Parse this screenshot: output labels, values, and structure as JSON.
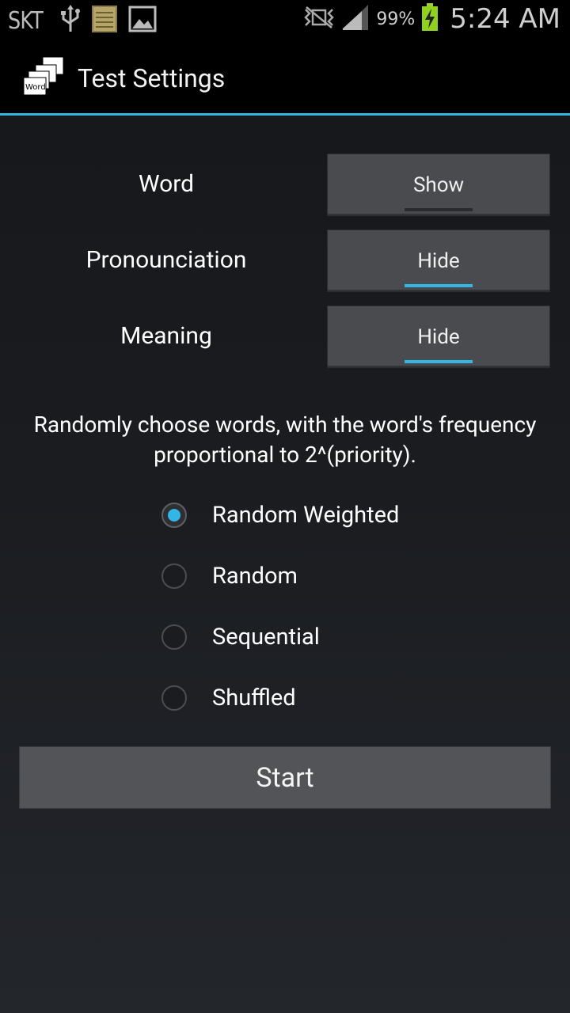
{
  "status_bar": {
    "carrier": "SKT",
    "battery_percent": "99%",
    "time": "5:24 AM",
    "icons": [
      "usb-icon",
      "notes-icon",
      "gallery-icon",
      "vibrate-icon",
      "signal-icon",
      "battery-charging-icon"
    ],
    "accent_color": "#33b5e5"
  },
  "action_bar": {
    "title": "Test Settings",
    "icon": "word-cards-app-icon"
  },
  "settings": {
    "word": {
      "label": "Word",
      "state": "Show"
    },
    "pronounciation": {
      "label": "Pronounciation",
      "state": "Hide"
    },
    "meaning": {
      "label": "Meaning",
      "state": "Hide"
    }
  },
  "mode": {
    "description": "Randomly choose words, with the word's frequency proportional to 2^(priority).",
    "options": [
      {
        "label": "Random Weighted",
        "selected": true
      },
      {
        "label": "Random",
        "selected": false
      },
      {
        "label": "Sequential",
        "selected": false
      },
      {
        "label": "Shuffled",
        "selected": false
      }
    ]
  },
  "start_button": {
    "label": "Start"
  }
}
